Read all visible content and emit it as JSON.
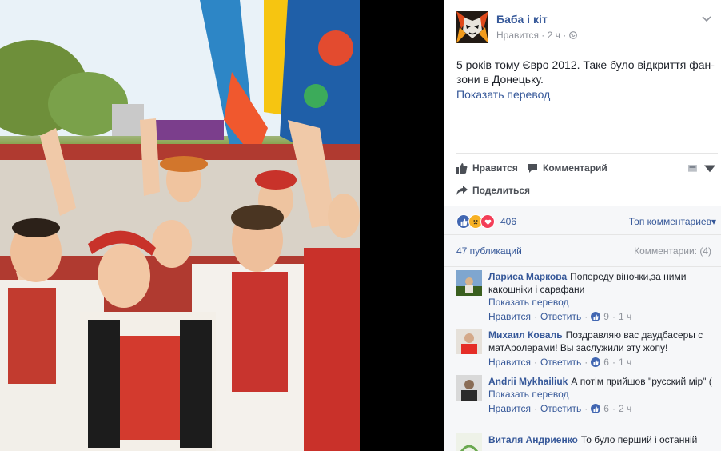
{
  "post": {
    "page_name": "Баба і кіт",
    "meta_liked": "Нравится",
    "meta_time": "2 ч",
    "text": "5 років тому Євро 2012. Таке було відкриття фан-зони в Донецьку.",
    "translate": "Показать перевод"
  },
  "actions": {
    "like": "Нравится",
    "comment": "Комментарий",
    "share": "Поделиться"
  },
  "reactions": {
    "count": "406",
    "top_comments": "Топ комментариев"
  },
  "publications": {
    "left": "47 публикаций",
    "right": "Комментарии: (4)"
  },
  "comments": [
    {
      "author": "Лариса Маркова",
      "text": "Попереду віночки,за ними какошніки і сарафани",
      "translate": "Показать перевод",
      "like": "Нравится",
      "reply": "Ответить",
      "likes": "9",
      "age": "1 ч"
    },
    {
      "author": "Михаил Коваль",
      "text": "Поздравляю вас даудбасеры с матАролерами! Вы заслужили эту жопу!",
      "like": "Нравится",
      "reply": "Ответить",
      "likes": "6",
      "age": "1 ч"
    },
    {
      "author": "Andrii Mykhailiuk",
      "text": "А потім прийшов \"русский мір\" (",
      "translate": "Показать перевод",
      "like": "Нравится",
      "reply": "Ответить",
      "likes": "6",
      "age": "2 ч"
    },
    {
      "author": "Виталя Андриенко",
      "text": "То було перший і останній"
    }
  ],
  "colors": {
    "link": "#365899",
    "muted": "#90949c",
    "panel_bg": "#f6f7f9",
    "like_blue": "#4267b2",
    "love_red": "#f33e58",
    "haha_yellow": "#f7b125"
  }
}
